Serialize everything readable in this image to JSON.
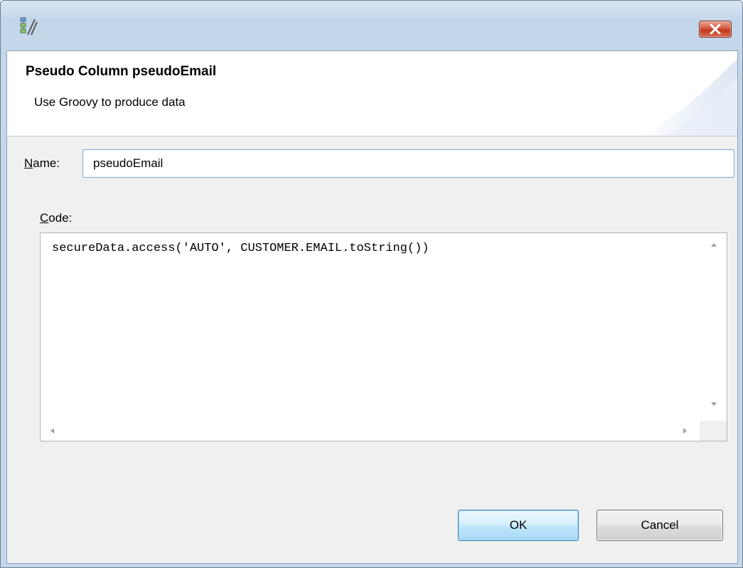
{
  "window": {
    "close_glyph": "✕"
  },
  "banner": {
    "title": "Pseudo Column pseudoEmail",
    "description": "Use Groovy to produce data"
  },
  "name_field": {
    "label_mnemonic": "N",
    "label_rest": "ame:",
    "value": "pseudoEmail"
  },
  "code_field": {
    "label_mnemonic": "C",
    "label_rest": "ode:",
    "value": "secureData.access('AUTO', CUSTOMER.EMAIL.toString())"
  },
  "buttons": {
    "ok_label": "OK",
    "cancel_label": "Cancel"
  },
  "colors": {
    "title_bar": "#c4d6ea",
    "close_button": "#c7432a",
    "ok_button_border": "#3c7fb1",
    "dialog_background": "#f0f0f0"
  },
  "icons": {
    "app": "pseudo-column-edit-icon",
    "close": "close-icon"
  }
}
